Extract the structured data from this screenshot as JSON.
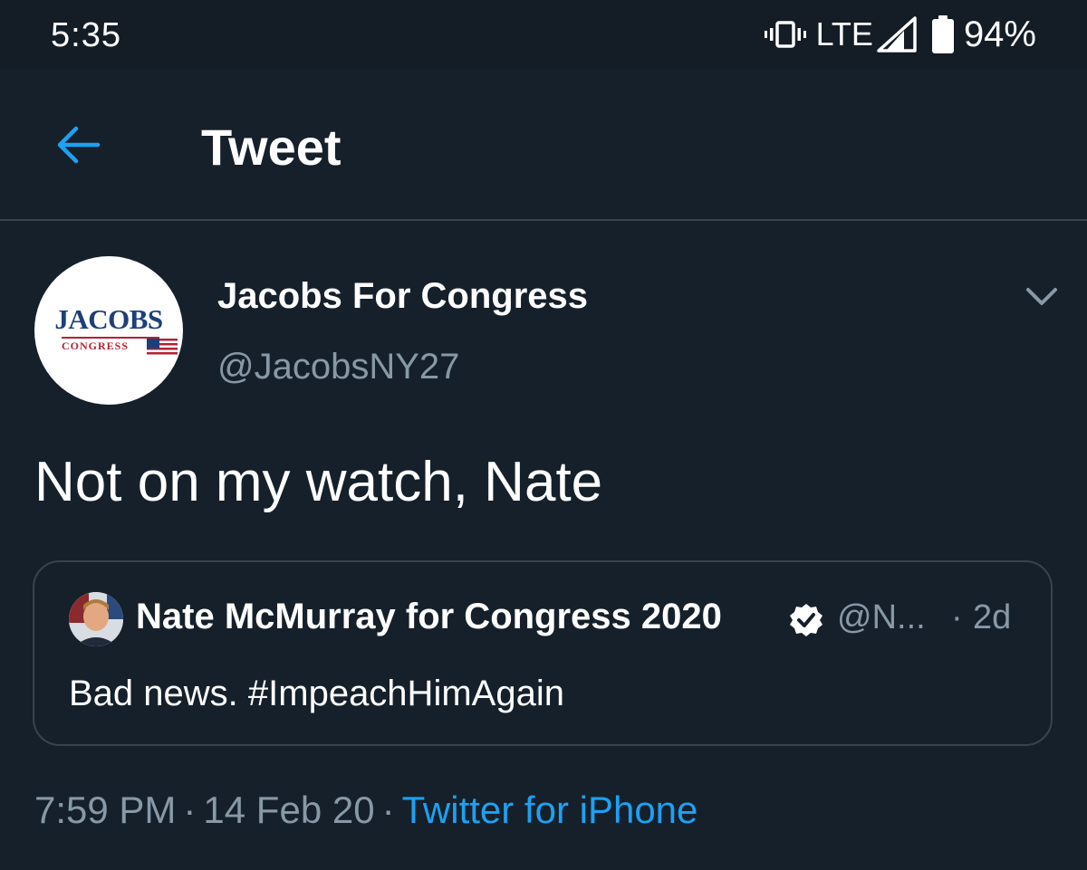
{
  "status_bar": {
    "time": "5:35",
    "network": "LTE",
    "battery": "94%",
    "icons": [
      "vibrate-icon",
      "signal-icon",
      "battery-icon"
    ]
  },
  "header": {
    "title": "Tweet",
    "back_icon": "arrow-left-icon"
  },
  "tweet": {
    "author": {
      "name": "Jacobs For Congress",
      "handle": "@JacobsNY27",
      "avatar_text": "JACOBS",
      "avatar_subtext": "CONGRESS"
    },
    "text": "Not on my watch, Nate",
    "quoted": {
      "name": "Nate McMurray for Congress 2020",
      "handle": "@N...",
      "separator": "·",
      "time": "2d",
      "text": "Bad news. #ImpeachHimAgain"
    },
    "meta": {
      "time": "7:59 PM",
      "date": "14 Feb 20",
      "separator": "·",
      "source": "Twitter for iPhone"
    }
  },
  "colors": {
    "background": "#15202b",
    "accent": "#1da1f2",
    "muted": "#8899a6",
    "border": "#38444d"
  }
}
